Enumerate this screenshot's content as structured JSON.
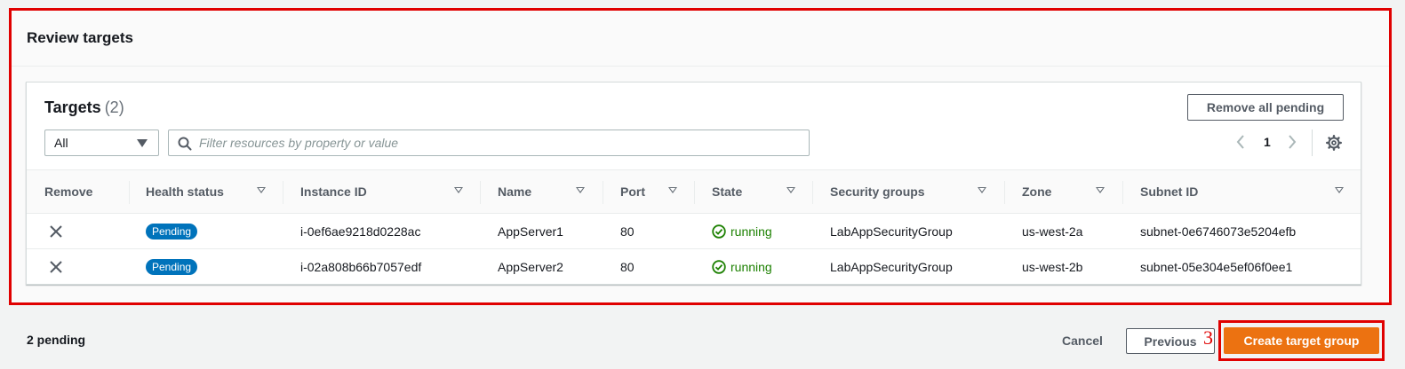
{
  "section": {
    "title": "Review targets"
  },
  "targets": {
    "title": "Targets",
    "count": "(2)",
    "remove_all_label": "Remove all pending",
    "filter_select_value": "All",
    "filter_placeholder": "Filter resources by property or value",
    "page_number": "1",
    "columns": [
      "Remove",
      "Health status",
      "Instance ID",
      "Name",
      "Port",
      "State",
      "Security groups",
      "Zone",
      "Subnet ID"
    ],
    "rows": [
      {
        "health": "Pending",
        "instance_id": "i-0ef6ae9218d0228ac",
        "name": "AppServer1",
        "port": "80",
        "state": "running",
        "security_group": "LabAppSecurityGroup",
        "zone": "us-west-2a",
        "subnet": "subnet-0e6746073e5204efb"
      },
      {
        "health": "Pending",
        "instance_id": "i-02a808b66b7057edf",
        "name": "AppServer2",
        "port": "80",
        "state": "running",
        "security_group": "LabAppSecurityGroup",
        "zone": "us-west-2b",
        "subnet": "subnet-05e304e5ef06f0ee1"
      }
    ]
  },
  "footer": {
    "pending_text": "2 pending",
    "cancel_label": "Cancel",
    "previous_label": "Previous",
    "annotation": "3",
    "create_label": "Create target group"
  },
  "colors": {
    "primary": "#ec7211",
    "badge": "#0073bb",
    "running": "#1d8102",
    "annotation": "#e00000"
  }
}
